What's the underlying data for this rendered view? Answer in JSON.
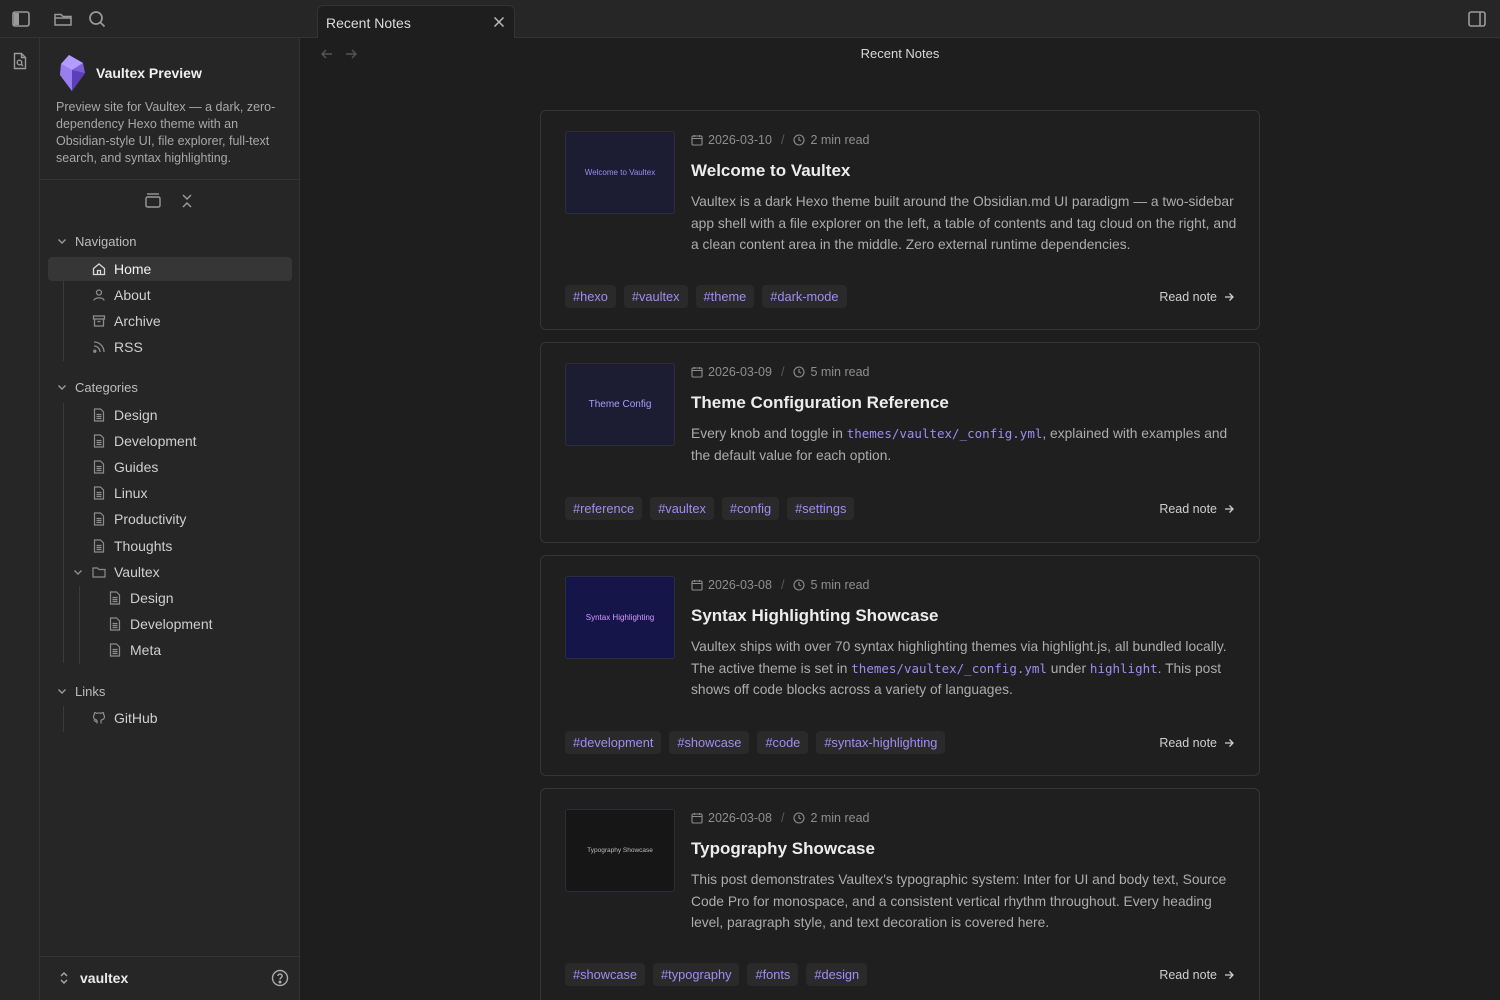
{
  "window": {
    "tab_label": "Recent Notes",
    "view_title": "Recent Notes"
  },
  "site": {
    "title": "Vaultex Preview",
    "description": "Preview site for Vaultex — a dark, zero-dependency Hexo theme with an Obsidian-style UI, file explorer, full-text search, and syntax highlighting."
  },
  "sidebar": {
    "navigation": {
      "heading": "Navigation",
      "items": [
        {
          "label": "Home",
          "icon": "home-icon"
        },
        {
          "label": "About",
          "icon": "user-icon"
        },
        {
          "label": "Archive",
          "icon": "archive-icon"
        },
        {
          "label": "RSS",
          "icon": "rss-icon"
        }
      ]
    },
    "categories": {
      "heading": "Categories",
      "items": [
        "Design",
        "Development",
        "Guides",
        "Linux",
        "Productivity",
        "Thoughts"
      ],
      "folder": {
        "label": "Vaultex",
        "children": [
          "Design",
          "Development",
          "Meta"
        ]
      }
    },
    "links": {
      "heading": "Links",
      "items": [
        "GitHub"
      ]
    },
    "vault_name": "vaultex"
  },
  "cards": [
    {
      "thumb": "Welcome to Vaultex",
      "date": "2026-03-10",
      "read_time": "2 min read",
      "title": "Welcome to Vaultex",
      "excerpt_plain": "Vaultex is a dark Hexo theme built around the Obsidian.md UI paradigm — a two-sidebar app shell with a file explorer on the left, a table of contents and tag cloud on the right, and a clean content area in the middle. Zero external runtime dependencies.",
      "tags": [
        "#hexo",
        "#vaultex",
        "#theme",
        "#dark-mode"
      ],
      "read_label": "Read note"
    },
    {
      "thumb": "Theme Config",
      "date": "2026-03-09",
      "read_time": "5 min read",
      "title": "Theme Configuration Reference",
      "excerpt_a": "Every knob and toggle in ",
      "excerpt_code": "themes/vaultex/_config.yml",
      "excerpt_b": ", explained with examples and the default value for each option.",
      "tags": [
        "#reference",
        "#vaultex",
        "#config",
        "#settings"
      ],
      "read_label": "Read note"
    },
    {
      "thumb": "Syntax Highlighting",
      "date": "2026-03-08",
      "read_time": "5 min read",
      "title": "Syntax Highlighting Showcase",
      "excerpt_a": "Vaultex ships with over 70 syntax highlighting themes via highlight.js, all bundled locally. The active theme is set in ",
      "excerpt_code": "themes/vaultex/_config.yml",
      "excerpt_b": " under ",
      "excerpt_code2": "highlight",
      "excerpt_c": ". This post shows off code blocks across a variety of languages.",
      "tags": [
        "#development",
        "#showcase",
        "#code",
        "#syntax-highlighting"
      ],
      "read_label": "Read note"
    },
    {
      "thumb": "Typography Showcase",
      "date": "2026-03-08",
      "read_time": "2 min read",
      "title": "Typography Showcase",
      "excerpt_plain": "This post demonstrates Vaultex's typographic system: Inter for UI and body text, Source Code Pro for monospace, and a consistent vertical rhythm throughout. Every heading level, paragraph style, and text decoration is covered here.",
      "tags": [
        "#showcase",
        "#typography",
        "#fonts",
        "#design"
      ],
      "read_label": "Read note"
    }
  ],
  "colors": {
    "accent": "#a18cf4",
    "background": "#1e1e1e",
    "sidebar": "#262626"
  }
}
